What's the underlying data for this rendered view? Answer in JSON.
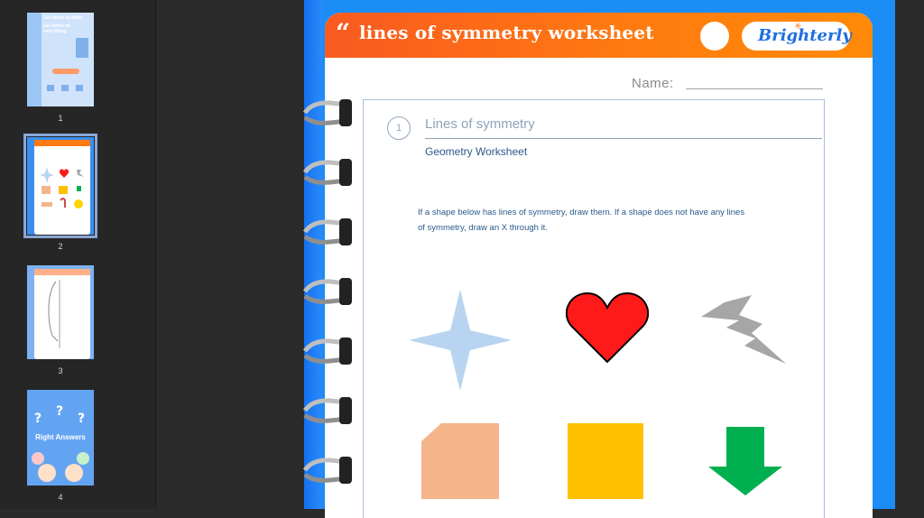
{
  "sidebar": {
    "thumbnails": [
      {
        "page_number": "1",
        "heading1": "Get better at Math.",
        "heading2": "Get better at everything."
      },
      {
        "page_number": "2"
      },
      {
        "page_number": "3"
      },
      {
        "page_number": "4",
        "caption": "Right Answers"
      }
    ]
  },
  "worksheet": {
    "title": "lines of symmetry worksheet",
    "brand": "Brighterly",
    "name_label": "Name:",
    "step_number": "1",
    "section_title": "Lines of symmetry",
    "section_subtitle": "Geometry Worksheet",
    "instructions_line1": "If a shape below has lines of symmetry, draw them. If a shape does not have any lines",
    "instructions_line2": "of symmetry, draw an X through it."
  },
  "colors": {
    "header_orange": "#ff7a10",
    "page_blue": "#1c8cf7",
    "star_blue": "#b8d4f0",
    "heart_red": "#ff1a1a",
    "bolt_gray": "#a6a6a6",
    "pentagon_peach": "#f5b58a",
    "square_yellow": "#ffc000",
    "arrow_green": "#00b050"
  },
  "shapes": [
    {
      "name": "four-point-star"
    },
    {
      "name": "heart"
    },
    {
      "name": "lightning-bolt"
    },
    {
      "name": "cut-corner-square"
    },
    {
      "name": "square"
    },
    {
      "name": "down-arrow"
    }
  ]
}
